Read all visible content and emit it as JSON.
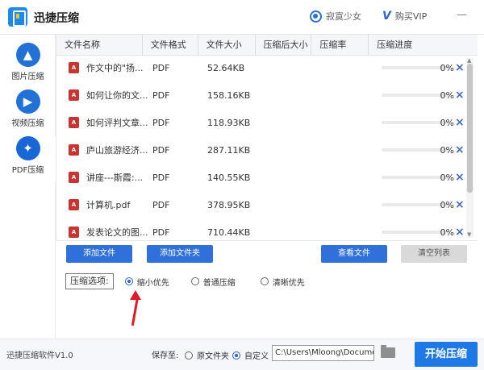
{
  "app": {
    "title": "迅捷压缩"
  },
  "user": {
    "name": "寂寞少女"
  },
  "vip": {
    "label": "购买VIP"
  },
  "sidebar": {
    "items": [
      {
        "label": "图片压缩",
        "icon": "image-icon"
      },
      {
        "label": "视频压缩",
        "icon": "play-icon"
      },
      {
        "label": "PDF压缩",
        "icon": "pdf-icon"
      }
    ]
  },
  "table": {
    "headers": [
      "文件名称",
      "文件格式",
      "文件大小",
      "压缩后大小",
      "压缩率",
      "压缩进度"
    ],
    "rows": [
      {
        "name": "作文中的\"扬...",
        "format": "PDF",
        "size": "52.64KB",
        "progress": "0%"
      },
      {
        "name": "如何让你的文...",
        "format": "PDF",
        "size": "158.16KB",
        "progress": "0%"
      },
      {
        "name": "如何评判文章...",
        "format": "PDF",
        "size": "118.93KB",
        "progress": "0%"
      },
      {
        "name": "庐山旅游经济...",
        "format": "PDF",
        "size": "287.11KB",
        "progress": "0%"
      },
      {
        "name": "讲座---斯霞:...",
        "format": "PDF",
        "size": "140.55KB",
        "progress": "0%"
      },
      {
        "name": "计算机.pdf",
        "format": "PDF",
        "size": "378.95KB",
        "progress": "0%"
      },
      {
        "name": "发表论文的图...",
        "format": "PDF",
        "size": "710.44KB",
        "progress": "0%"
      }
    ]
  },
  "buttons": {
    "add_file": "添加文件",
    "add_folder": "添加文件夹",
    "view_file": "查看文件",
    "clear_list": "清空列表",
    "start": "开始压缩"
  },
  "options": {
    "label": "压缩选项:",
    "choices": [
      "缩小优先",
      "普通压缩",
      "清晰优先"
    ],
    "selected": "缩小优先"
  },
  "footer": {
    "version": "迅捷压缩软件V1.0",
    "save_label": "保存至:",
    "save_choices": [
      "原文件夹",
      "自定义"
    ],
    "save_selected": "自定义",
    "path": "C:\\Users\\Mloong\\Docume"
  },
  "colors": {
    "primary": "#2f70da",
    "pdf_red": "#c9342f",
    "arrow_red": "#e0192b",
    "progress_blue": "#4ba6ff"
  }
}
